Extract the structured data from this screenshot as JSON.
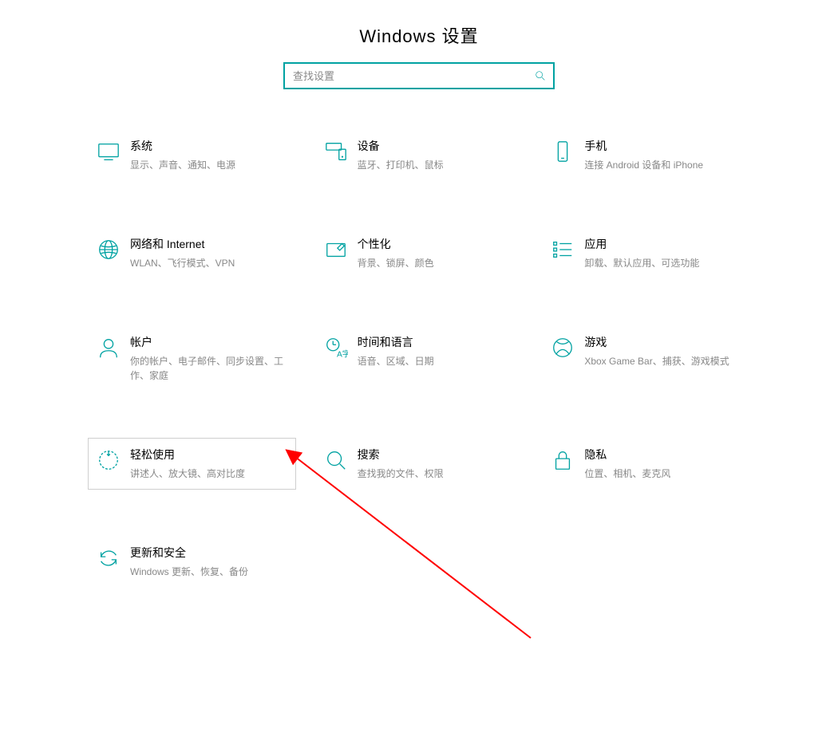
{
  "page": {
    "title": "Windows 设置"
  },
  "search": {
    "placeholder": "查找设置"
  },
  "tiles": {
    "system": {
      "title": "系统",
      "desc": "显示、声音、通知、电源"
    },
    "devices": {
      "title": "设备",
      "desc": "蓝牙、打印机、鼠标"
    },
    "phone": {
      "title": "手机",
      "desc": "连接 Android 设备和 iPhone"
    },
    "network": {
      "title": "网络和 Internet",
      "desc": "WLAN、飞行模式、VPN"
    },
    "personalize": {
      "title": "个性化",
      "desc": "背景、锁屏、颜色"
    },
    "apps": {
      "title": "应用",
      "desc": "卸载、默认应用、可选功能"
    },
    "accounts": {
      "title": "帐户",
      "desc": "你的帐户、电子邮件、同步设置、工作、家庭"
    },
    "timelang": {
      "title": "时间和语言",
      "desc": "语音、区域、日期"
    },
    "gaming": {
      "title": "游戏",
      "desc": "Xbox Game Bar、捕获、游戏模式"
    },
    "ease": {
      "title": "轻松使用",
      "desc": "讲述人、放大镜、高对比度"
    },
    "searchcat": {
      "title": "搜索",
      "desc": "查找我的文件、权限"
    },
    "privacy": {
      "title": "隐私",
      "desc": "位置、相机、麦克风"
    },
    "update": {
      "title": "更新和安全",
      "desc": "Windows 更新、恢复、备份"
    }
  },
  "colors": {
    "accent": "#00a2a2",
    "arrow": "#ff0000"
  }
}
